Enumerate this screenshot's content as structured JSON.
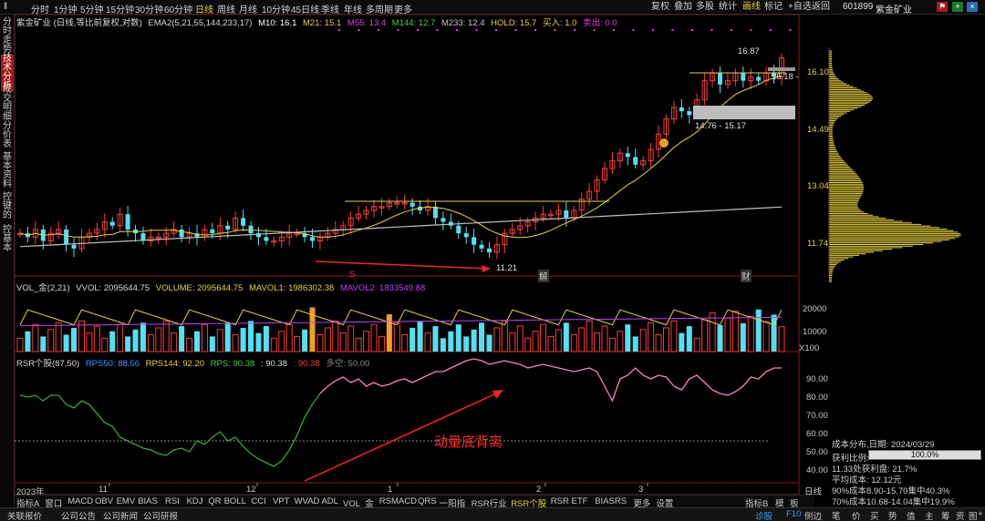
{
  "topbar": {
    "tf_prefix": "‖",
    "timeframes": [
      "分时",
      "1分钟",
      "5分钟",
      "15分钟",
      "30分钟",
      "60分钟",
      "日线",
      "周线",
      "月线",
      "10分钟",
      "45日线",
      "季线",
      "年线",
      "多周期",
      "更多"
    ],
    "active_timeframe": "日线",
    "right_buttons": [
      "复权",
      "叠加",
      "多股",
      "统计",
      "画线",
      "标记",
      "+自选",
      "返回"
    ],
    "active_right": "画线",
    "stock_code": "601899",
    "stock_name": "紫金矿业"
  },
  "leftbar": {
    "tabs": [
      "分时走势",
      "技术分析",
      "成交明细",
      "分价表",
      "基本资料",
      "控键的",
      "控基本"
    ],
    "active": "技术分析"
  },
  "price_panel": {
    "name_info": "紫金矿业 (日线,等比前复权,对数)",
    "ema_label": "EMA2(5,21,55,144,233,17)",
    "m10": "M10: 16.1",
    "m21": "M21: 15.1",
    "m55": "M55: 13.4",
    "m144": "M144: 12.7",
    "m233": "M233: 12.4",
    "hold": "HOLD: 15.7",
    "buy": "买入: 1.0",
    "sell": "卖出: 0.0",
    "high_label": "16.87",
    "last_label": "16.18 -",
    "zone_label": "14.76 - 15.17",
    "low_label": "11.21",
    "s_marker": "S",
    "jie_marker": "解",
    "cai_marker": "财",
    "y_ticks": [
      "16.10",
      "14.49",
      "13.04",
      "11.74"
    ]
  },
  "vol_panel": {
    "label": "VOL_金(2,21)",
    "vvol": "VVOL: 2095644.75",
    "volume": "VOLUME: 2095644.75",
    "mavol1": "MAVOL1: 1986302.38",
    "mavol2": "MAVOL2: 1833549.88",
    "y_ticks": [
      "20000",
      "10000"
    ],
    "unit": "X100"
  },
  "rsr_panel": {
    "label": "RSR个股(87,50)",
    "rps50": "RPS50: 88.56",
    "rps144": "RPS144: 92.20",
    "rps": "RPS: 90.38",
    "v1": ": 90.38",
    "v2": ": 90.38",
    "duokong": "多空: 50.00",
    "annotation": "动量底背离",
    "y_ticks": [
      "90.00",
      "80.00",
      "70.00",
      "60.00",
      "50.00",
      "40.00"
    ]
  },
  "x_axis": {
    "labels": [
      "2023年",
      "11",
      "12",
      "1",
      "2",
      "3"
    ],
    "period": "日线"
  },
  "bottom_tabs": [
    "指标A",
    "窗口",
    "MACD",
    "OBV",
    "EMV",
    "BIAS",
    "RSI",
    "KDJ",
    "QR",
    "BOLL",
    "CCI",
    "VPT",
    "WVAD",
    "ADL",
    "VOL_金",
    "RSMACD",
    "QRS",
    "一阳指",
    "RSR行业",
    "RSR个股",
    "RSR ETF",
    "BIASRS",
    "更多",
    "设置"
  ],
  "active_bottom_tab": "RSR个股",
  "bottom_right": [
    "指标B",
    "模",
    "板"
  ],
  "status_left": [
    "关联报价",
    "公司公告",
    "公司新闻",
    "公司研报"
  ],
  "status_right": [
    "诊股",
    "F10",
    "侧边",
    "笔",
    "价",
    "买",
    "势",
    "值",
    "主",
    "筹",
    "资",
    "图",
    "+"
  ],
  "side_info": {
    "title": "成本分布,日期: 2024/03/29",
    "profit_label": "获利比例:",
    "profit_value": "100.0%",
    "profit_fraction": 1.0,
    "line1": "11.33处获利盘: 21.7%",
    "line2": "平均成本: 12.12元",
    "line3": "90%成本8.90-15.70集中40.3%",
    "line4": "70%成本10.68-14.04集中19.9%"
  },
  "colors": {
    "up": "#ff3b3b",
    "down": "#52e1f2",
    "ma10": "#ffffff",
    "ma21": "#e8d23a",
    "ma_long": "#c0c0c0",
    "rsr": "#ff80c0",
    "rsr_green": "#3cd33c",
    "arrow": "#ff2020",
    "vol_ma1": "#e8d23a",
    "vol_ma2": "#c040ff"
  }
}
